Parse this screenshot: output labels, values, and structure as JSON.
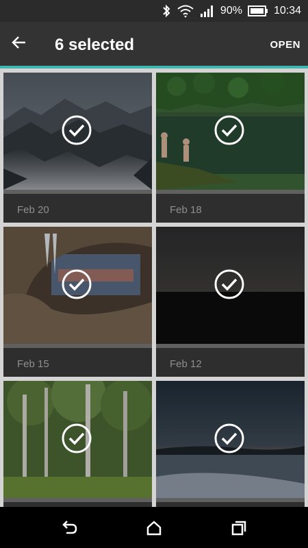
{
  "status_bar": {
    "battery_percent": "90%",
    "time": "10:34",
    "icons": [
      "bluetooth-icon",
      "wifi-icon",
      "signal-icon",
      "battery-icon"
    ]
  },
  "app_bar": {
    "title": "6 selected",
    "action": "OPEN",
    "back_icon": "arrow-left-icon"
  },
  "photos": [
    {
      "date": "Feb 20",
      "subject": "misty mountains",
      "selected": true
    },
    {
      "date": "Feb 18",
      "subject": "lake with swimmers",
      "selected": true
    },
    {
      "date": "Feb 15",
      "subject": "rock arch with icicles",
      "selected": true
    },
    {
      "date": "Feb 12",
      "subject": "dusk sky over dark land",
      "selected": true
    },
    {
      "date": "",
      "subject": "birch forest",
      "selected": true
    },
    {
      "date": "",
      "subject": "lake at twilight",
      "selected": true
    }
  ],
  "nav_bar": {
    "icons": [
      "back-icon",
      "home-icon",
      "recents-icon"
    ]
  },
  "colors": {
    "accent": "#3fb6b0",
    "app_bar": "#333333",
    "status_bar": "#2b2b2b",
    "card": "#2e2e2e"
  }
}
